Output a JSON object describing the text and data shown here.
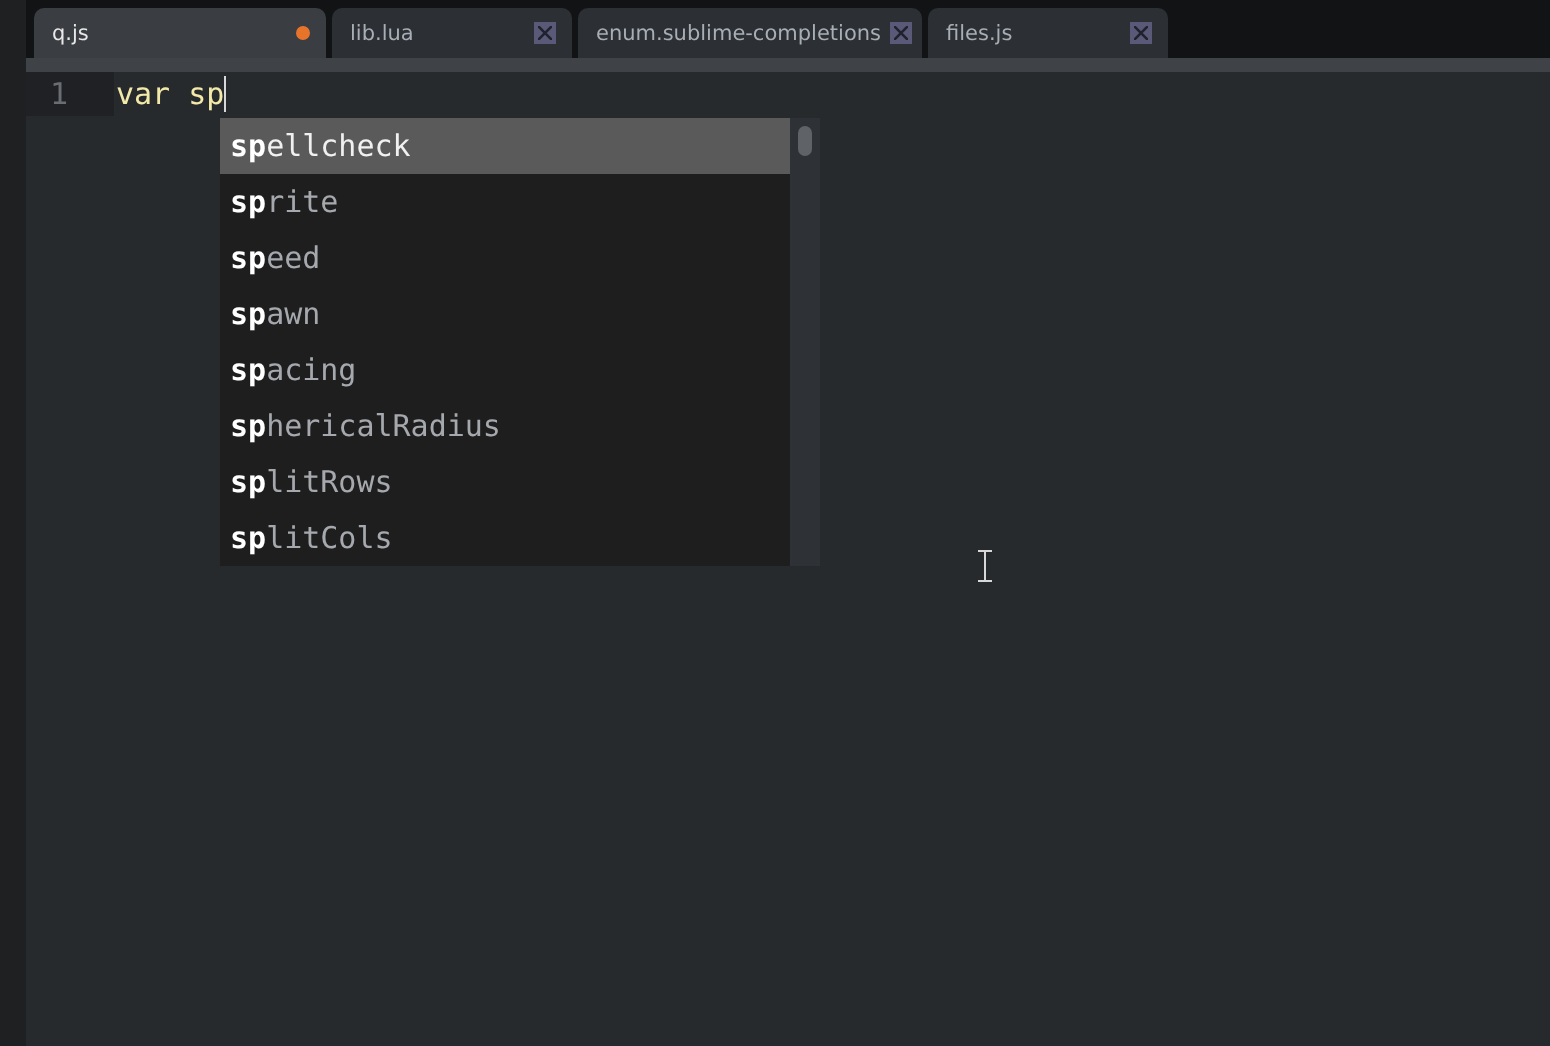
{
  "tabs": [
    {
      "label": "q.js",
      "selected": true,
      "modified": true
    },
    {
      "label": "lib.lua",
      "selected": false,
      "modified": false
    },
    {
      "label": "enum.sublime-completions",
      "selected": false,
      "modified": false
    },
    {
      "label": "files.js",
      "selected": false,
      "modified": false
    }
  ],
  "editor": {
    "line_number": "1",
    "code": "var sp"
  },
  "completions": [
    {
      "text": "**sp**ellcheck",
      "selected": true
    },
    {
      "text": "**sp**rite",
      "selected": false
    },
    {
      "text": "**sp**eed",
      "selected": false
    },
    {
      "text": "**sp**awn",
      "selected": false
    },
    {
      "text": "**sp**acing",
      "selected": false
    },
    {
      "text": "**sp**hericalRadius",
      "selected": false
    },
    {
      "text": "**sp**litRows",
      "selected": false
    },
    {
      "text": "**sp**litCols",
      "selected": false
    }
  ]
}
